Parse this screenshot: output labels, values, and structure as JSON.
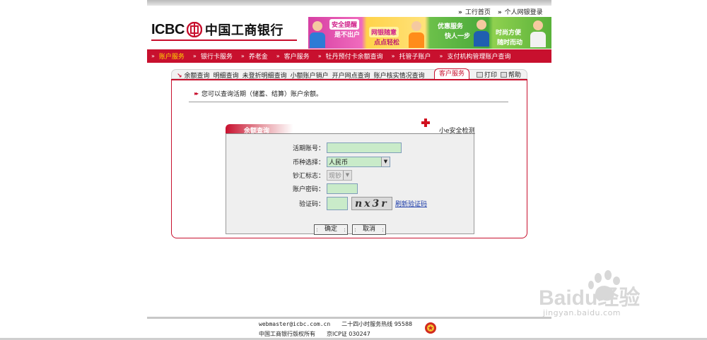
{
  "top_links": [
    "工行首页",
    "个人网银登录"
  ],
  "logo": {
    "latin": "ICBC",
    "chinese": "中国工商银行",
    "brand_color": "#c8102e"
  },
  "banner": {
    "ad1_lines": [
      "安全提醒",
      "是不出户"
    ],
    "ad1_tag": "网银随意",
    "ad1_tag2": "点点轻松",
    "ad2_lines": [],
    "ad3_lines": [
      "优惠服务",
      "快人一步"
    ],
    "ad4_lines": [
      "时尚方便",
      "随时而动"
    ]
  },
  "nav": [
    {
      "label": "账户服务",
      "active": true
    },
    {
      "label": "银行卡服务",
      "active": false
    },
    {
      "label": "养老金",
      "active": false
    },
    {
      "label": "客户服务",
      "active": false
    },
    {
      "label": "牡丹预付卡余额查询",
      "active": false
    },
    {
      "label": "托管子账户",
      "active": false
    },
    {
      "label": "支付机构管理账户查询",
      "active": false
    }
  ],
  "sub_tabs": [
    "余额查询",
    "明细查询",
    "未登折明细查询",
    "小额账户销户",
    "开户网点查询",
    "账户核实情况查询"
  ],
  "customer_tab": "客户服务",
  "tools": {
    "print": "打印",
    "help": "帮助"
  },
  "notice": "您可以查询活期（储蓄、结算）账户余额。",
  "security_link": "小e安全检测",
  "form": {
    "title": "余额查询",
    "account_label": "活期账号：",
    "account_value": "",
    "currency_label": "币种选择：",
    "currency_value": "人民币",
    "cash_label": "钞汇标志：",
    "cash_value": "现钞",
    "password_label": "账户密码：",
    "captcha_label": "验证码：",
    "captcha_text": "nx3r",
    "refresh_label": "刷新验证码",
    "confirm_label": "确定",
    "cancel_label": "取消"
  },
  "footer": {
    "email": "webmaster@icbc.com.cn",
    "hotline": "二十四小时服务热线 95588",
    "copyright": "中国工商银行版权所有",
    "icp": "京ICP证 030247"
  },
  "watermark": {
    "brand": "Baidu经验",
    "url": "jingyan.baidu.com"
  }
}
